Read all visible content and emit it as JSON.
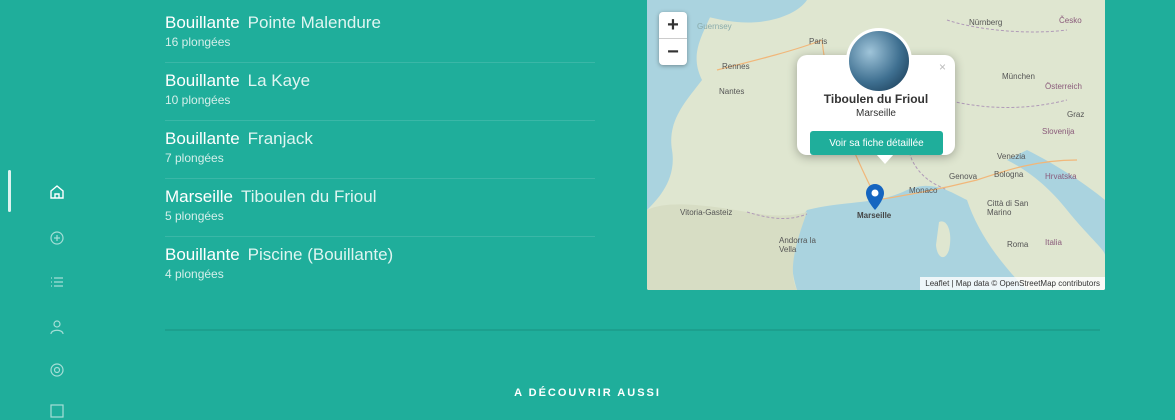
{
  "sidebar": {
    "icons": [
      {
        "name": "home-icon",
        "active": true
      },
      {
        "name": "add-circle-icon",
        "active": false
      },
      {
        "name": "list-icon",
        "active": false
      },
      {
        "name": "user-icon",
        "active": false
      },
      {
        "name": "eye-icon",
        "active": false
      },
      {
        "name": "grid-icon",
        "active": false
      }
    ]
  },
  "spots": [
    {
      "city": "Bouillante",
      "name": "Pointe Malendure",
      "count": "16 plongées"
    },
    {
      "city": "Bouillante",
      "name": "La Kaye",
      "count": "10 plongées"
    },
    {
      "city": "Bouillante",
      "name": "Franjack",
      "count": "7 plongées"
    },
    {
      "city": "Marseille",
      "name": "Tiboulen du Frioul",
      "count": "5 plongées"
    },
    {
      "city": "Bouillante",
      "name": "Piscine (Bouillante)",
      "count": "4 plongées"
    }
  ],
  "map": {
    "zoom_in": "+",
    "zoom_out": "−",
    "popup": {
      "title": "Tiboulen du Frioul",
      "subtitle": "Marseille",
      "button": "Voir sa fiche détaillée",
      "close": "×"
    },
    "labels": {
      "guernsey": "Guernsey",
      "paris": "Paris",
      "rennes": "Rennes",
      "nantes": "Nantes",
      "nurnberg": "Nürnberg",
      "cesko": "Česko",
      "munchen": "München",
      "osterreich": "Österreich",
      "graz": "Graz",
      "slovenija": "Slovenija",
      "venezia": "Venezia",
      "genova": "Genova",
      "bologna": "Bologna",
      "hrvatska": "Hrvatska",
      "monaco": "Monaco",
      "marseille": "Marseille",
      "vitoria": "Vitoria-Gasteiz",
      "andorra": "Andorra la Vella",
      "citta": "Città di San Marino",
      "roma": "Roma",
      "italia": "Italia"
    },
    "attribution": "Leaflet | Map data © OpenStreetMap contributors"
  },
  "discover_heading": "A DÉCOUVRIR AUSSI",
  "colors": {
    "accent": "#1fae9b",
    "marker": "#1565c0"
  }
}
